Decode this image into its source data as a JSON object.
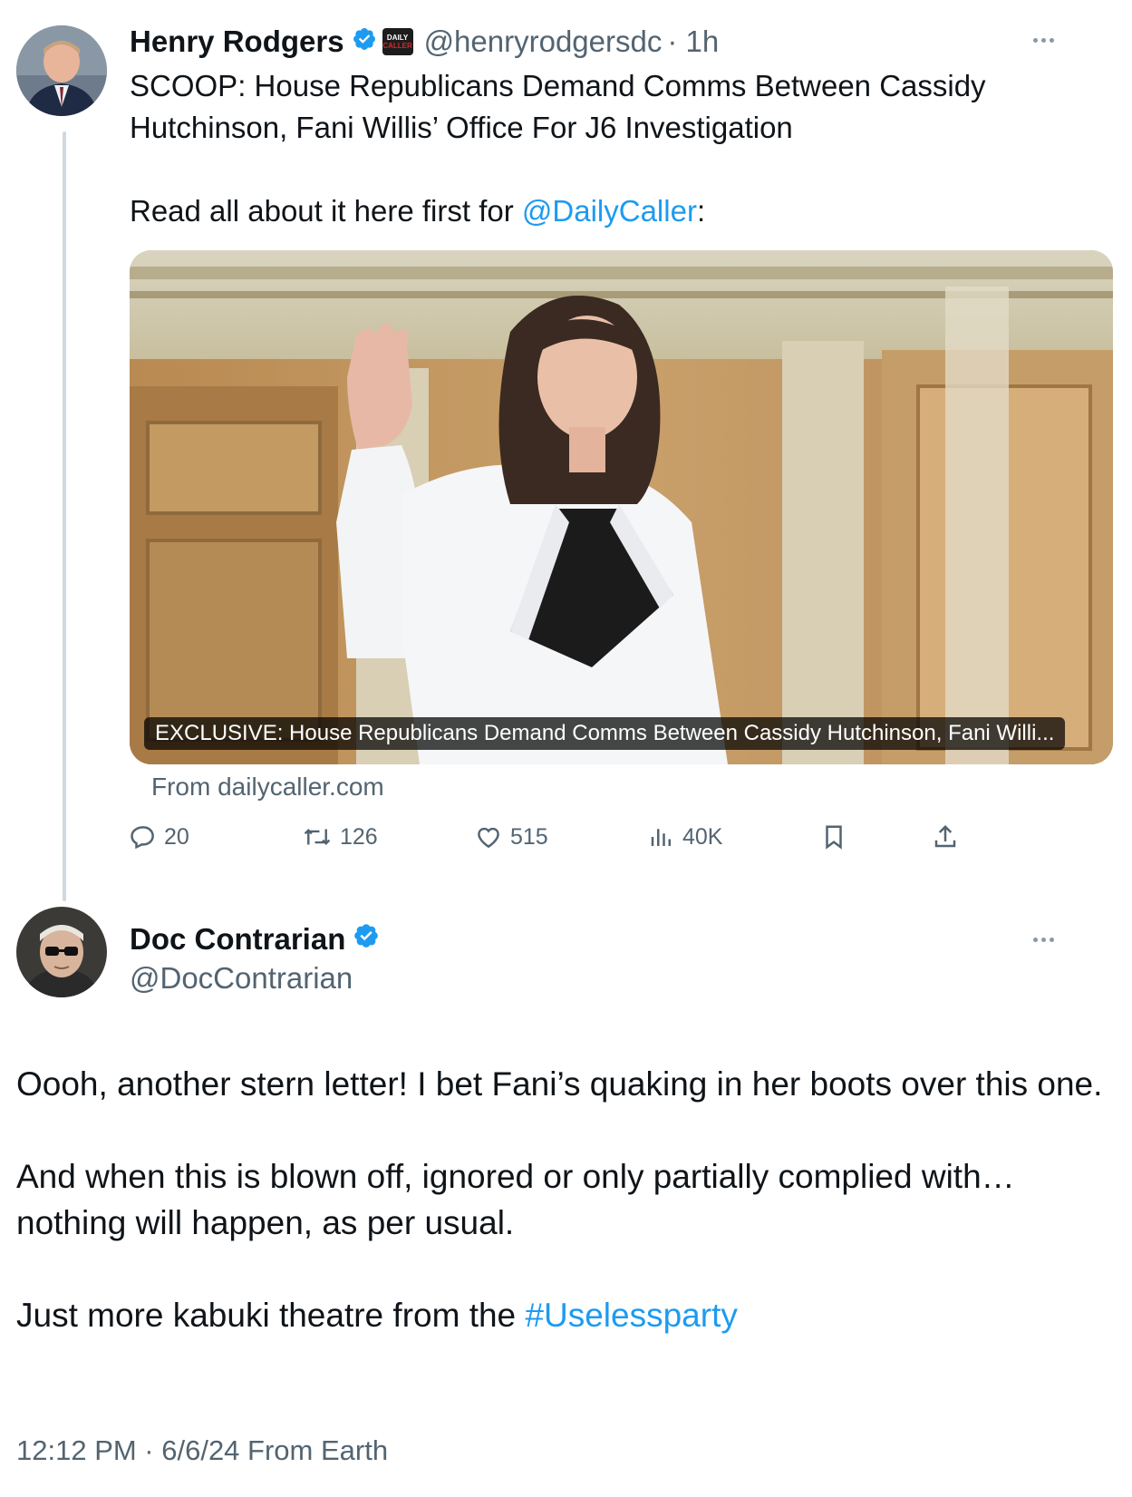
{
  "tweet1": {
    "name": "Henry Rodgers",
    "handle": "@henryrodgersdc",
    "time": "· 1h",
    "affiliate_badge": "Daily Caller",
    "text_line1": "SCOOP: House Republicans Demand Comms Between Cassidy Hutchinson, Fani Willis’ Office For J6 Investigation",
    "text_line2_prefix": "Read all about it here first for ",
    "text_line2_mention": "@DailyCaller",
    "text_line2_suffix": ":",
    "card": {
      "caption": "EXCLUSIVE: House Republicans Demand Comms Between Cassidy Hutchinson, Fani Willi...",
      "source": "From dailycaller.com"
    },
    "actions": {
      "replies": "20",
      "reposts": "126",
      "likes": "515",
      "views": "40K"
    }
  },
  "tweet2": {
    "name": "Doc Contrarian",
    "handle": "@DocContrarian",
    "para1": "Oooh, another stern letter! I bet Fani’s quaking in her boots over this one.",
    "para2": "And when this is blown off, ignored or only partially complied with… nothing will happen, as per usual.",
    "para3_prefix": "Just more kabuki theatre from the ",
    "para3_hashtag": "#Uselessparty",
    "meta": "12:12 PM · 6/6/24 From Earth"
  },
  "colors": {
    "link": "#1d9bf0",
    "muted": "#536471",
    "verified": "#1d9bf0",
    "thread_line": "#cfd9de"
  },
  "icons": [
    "verified-badge-icon",
    "daily-caller-badge-icon",
    "more-icon",
    "reply-icon",
    "repost-icon",
    "like-icon",
    "views-icon",
    "bookmark-icon",
    "share-icon"
  ]
}
